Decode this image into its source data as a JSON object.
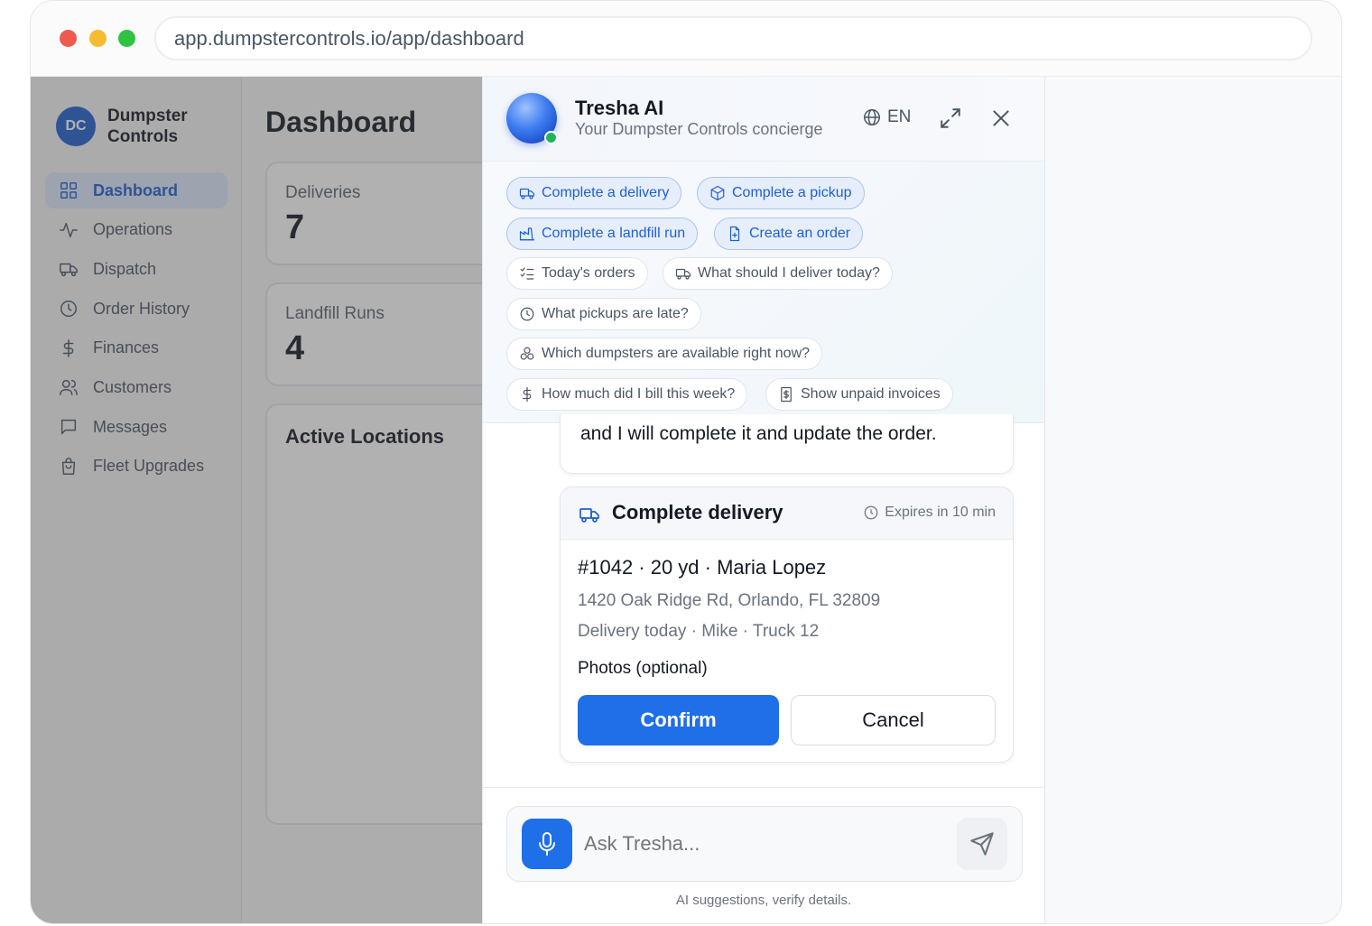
{
  "browser": {
    "url": "app.dumpstercontrols.io/app/dashboard"
  },
  "sidebar": {
    "logo_initials": "DC",
    "brand_name": "Dumpster Controls",
    "items": [
      {
        "label": "Dashboard",
        "icon": "grid-icon",
        "active": true
      },
      {
        "label": "Operations",
        "icon": "activity-icon"
      },
      {
        "label": "Dispatch",
        "icon": "truck-icon"
      },
      {
        "label": "Order History",
        "icon": "clock-icon"
      },
      {
        "label": "Finances",
        "icon": "dollar-icon"
      },
      {
        "label": "Customers",
        "icon": "users-icon"
      },
      {
        "label": "Messages",
        "icon": "message-icon"
      },
      {
        "label": "Fleet Upgrades",
        "icon": "shopping-bag-icon"
      }
    ]
  },
  "dashboard": {
    "title": "Dashboard",
    "cards": [
      {
        "label": "Deliveries",
        "value": "7"
      },
      {
        "label": "Landfill Runs",
        "value": "4"
      }
    ],
    "active_locations_title": "Active Locations"
  },
  "assistant": {
    "name": "Tresha AI",
    "subtitle": "Your Dumpster Controls concierge",
    "language": "EN",
    "status_color": "#22b35e",
    "suggestions_primary": [
      "Complete a delivery",
      "Complete a pickup",
      "Complete a landfill run",
      "Create an order"
    ],
    "suggestions_plain": [
      "Today's orders",
      "What should I deliver today?",
      "What pickups are late?",
      "Which dumpsters are available right now?",
      "How much did I bill this week?",
      "Show unpaid invoices"
    ],
    "message_text": "and I will complete it and update the order.",
    "action_card": {
      "title": "Complete delivery",
      "expires": "Expires in 10 min",
      "order_line": "#1042 · 20 yd · Maria Lopez",
      "address": "1420 Oak Ridge Rd, Orlando, FL 32809",
      "schedule": "Delivery today · Mike · Truck 12",
      "photos_label": "Photos (optional)",
      "confirm_label": "Confirm",
      "cancel_label": "Cancel"
    },
    "input_placeholder": "Ask Tresha...",
    "disclaimer": "AI suggestions, verify details."
  },
  "colors": {
    "accent": "#1f6fe8",
    "brand": "#1f5fd1"
  }
}
